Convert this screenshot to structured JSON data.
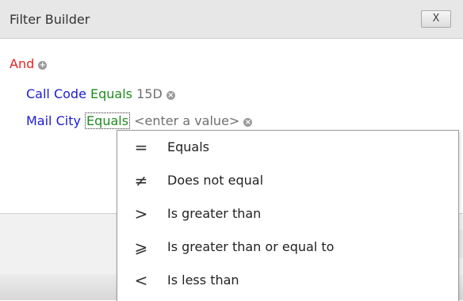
{
  "dialog": {
    "title": "Filter Builder",
    "close_label": "X"
  },
  "filter": {
    "group_operator": "And",
    "add_icon": "plus-circle-icon",
    "remove_icon": "x-circle-icon",
    "conditions": [
      {
        "field": "Call Code",
        "operator": "Equals",
        "value": "15D"
      },
      {
        "field": "Mail City",
        "operator": "Equals",
        "value": "<enter a value>"
      }
    ]
  },
  "operator_menu": {
    "items": [
      {
        "symbol": "=",
        "label": "Equals"
      },
      {
        "symbol": "≠",
        "label": "Does not equal"
      },
      {
        "symbol": ">",
        "label": "Is greater than"
      },
      {
        "symbol": "⩾",
        "label": "Is greater than or equal to"
      },
      {
        "symbol": "<",
        "label": "Is less than"
      }
    ]
  },
  "colors": {
    "group_operator": "#e8231f",
    "field": "#1c1cd6",
    "operator": "#1e8c1e",
    "value_placeholder": "#707070"
  }
}
